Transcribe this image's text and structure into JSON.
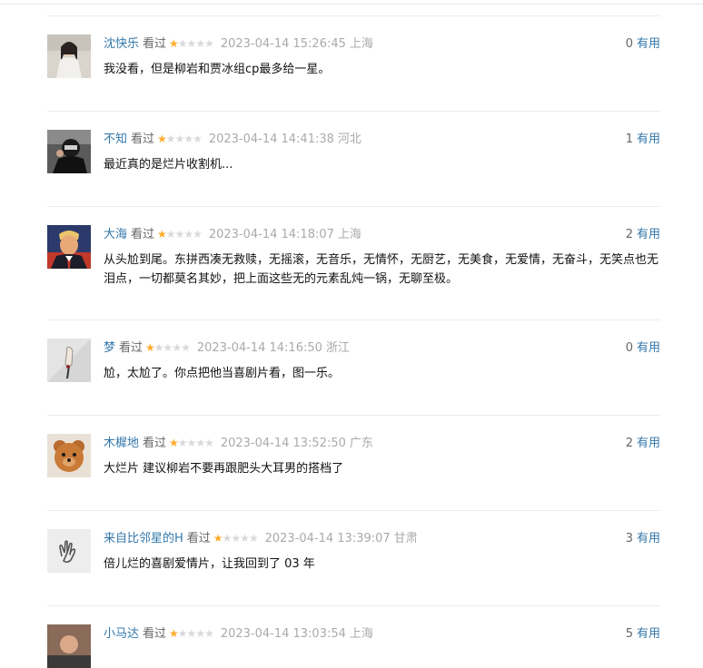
{
  "comments": [
    {
      "user": "沈快乐",
      "status": "看过",
      "rating": 1,
      "time": "2023-04-14 15:26:45",
      "location": "上海",
      "votes": "0",
      "useful_label": "有用",
      "text": "我没看，但是柳岩和贾冰组cp最多给一星。",
      "avatar_desc": "woman-photo-avatar"
    },
    {
      "user": "不知",
      "status": "看过",
      "rating": 1,
      "time": "2023-04-14 14:41:38",
      "location": "河北",
      "votes": "1",
      "useful_label": "有用",
      "text": "最近真的是烂片收割机...",
      "avatar_desc": "masked-person-avatar"
    },
    {
      "user": "大海",
      "status": "看过",
      "rating": 1,
      "time": "2023-04-14 14:18:07",
      "location": "上海",
      "votes": "2",
      "useful_label": "有用",
      "text": "从头尬到尾。东拼西凑无救赎，无摇滚，无音乐，无情怀，无厨艺，无美食，无爱情，无奋斗，无笑点也无泪点，一切都莫名其妙，把上面这些无的元素乱炖一锅，无聊至极。",
      "avatar_desc": "man-in-suit-avatar"
    },
    {
      "user": "梦",
      "status": "看过",
      "rating": 1,
      "time": "2023-04-14 14:16:50",
      "location": "浙江",
      "votes": "0",
      "useful_label": "有用",
      "text": "尬，太尬了。你点把他当喜剧片看，图一乐。",
      "avatar_desc": "hand-photo-avatar"
    },
    {
      "user": "木樨地",
      "status": "看过",
      "rating": 1,
      "time": "2023-04-14 13:52:50",
      "location": "广东",
      "votes": "2",
      "useful_label": "有用",
      "text": "大烂片 建议柳岩不要再跟肥头大耳男的搭档了",
      "avatar_desc": "teddy-bear-avatar"
    },
    {
      "user": "来自比邻星的H",
      "status": "看过",
      "rating": 1,
      "time": "2023-04-14 13:39:07",
      "location": "甘肃",
      "votes": "3",
      "useful_label": "有用",
      "text": "倍儿烂的喜剧爱情片，让我回到了 03 年",
      "avatar_desc": "hand-gesture-avatar"
    },
    {
      "user": "小马达",
      "status": "看过",
      "rating": 1,
      "time": "2023-04-14 13:03:54",
      "location": "上海",
      "votes": "5",
      "useful_label": "有用",
      "text": "",
      "avatar_desc": "photo-avatar"
    }
  ],
  "colors": {
    "link": "#3377aa",
    "star": "#ffac2d",
    "meta_gray": "#aaaaaa"
  }
}
